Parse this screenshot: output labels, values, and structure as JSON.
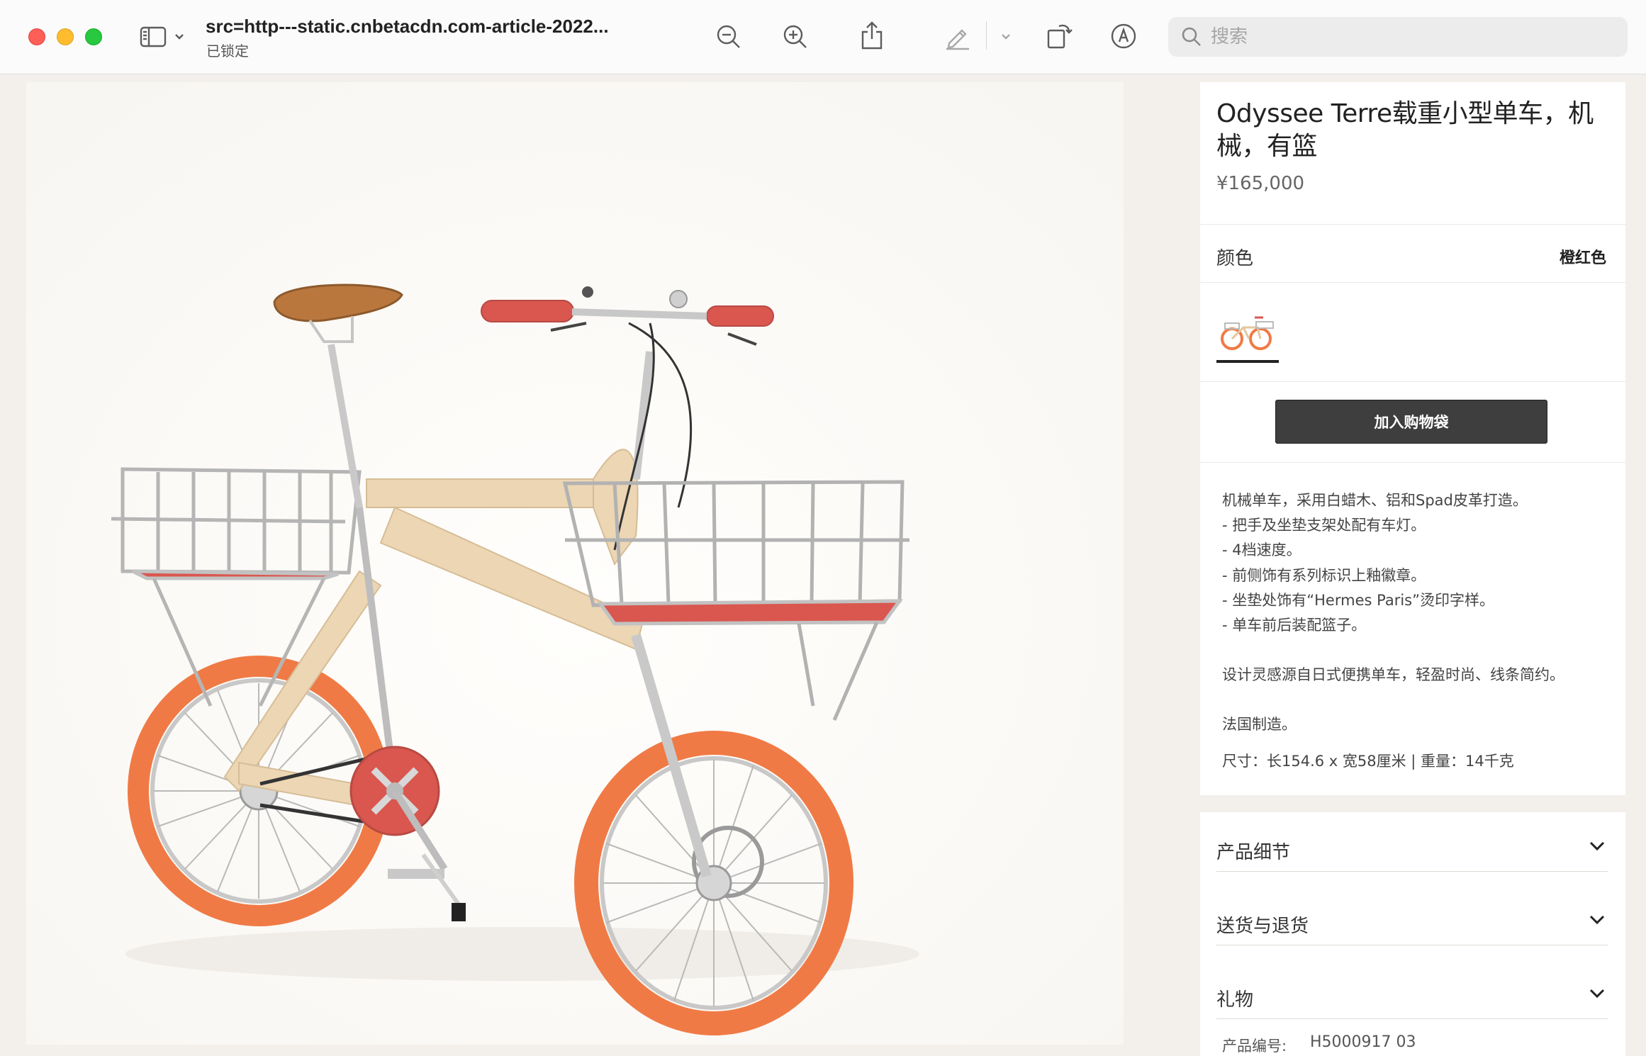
{
  "window": {
    "title": "src=http---static.cnbetacdn.com-article-2022...",
    "subtitle": "已锁定"
  },
  "toolbar": {
    "icons": [
      "sidebar-icon",
      "chevron-down-icon",
      "zoom-out-icon",
      "zoom-in-icon",
      "share-icon",
      "markup-pen-icon",
      "chevron-down-icon",
      "rotate-icon",
      "annotate-icon"
    ],
    "search_placeholder": "搜索",
    "search_value": ""
  },
  "product": {
    "title": "Odyssee Terre载重小型单车，机械，有篮",
    "price": "¥165,000",
    "color_label": "颜色",
    "color_value": "橙红色",
    "add_to_bag": "加入购物袋",
    "description": [
      "机械单车，采用白蜡木、铝和Spad皮革打造。",
      "- 把手及坐垫支架处配有车灯。",
      "- 4档速度。",
      "- 前侧饰有系列标识上釉徽章。",
      "- 坐垫处饰有“Hermes Paris”烫印字样。",
      "- 单车前后装配篮子。",
      "设计灵感源自日式便携单车，轻盈时尚、线条简约。",
      "法国制造。",
      "尺寸：长154.6 x 宽58厘米 | 重量：14千克"
    ],
    "accordion": [
      "产品细节",
      "送货与退货",
      "礼物"
    ],
    "sku_label": "产品编号:",
    "sku_value": "H5000917 03"
  },
  "colors": {
    "tire": "#f07a45",
    "frame": "#ecd6b4",
    "accent_red": "#d9574f",
    "button_bg": "#3e3e3e"
  }
}
